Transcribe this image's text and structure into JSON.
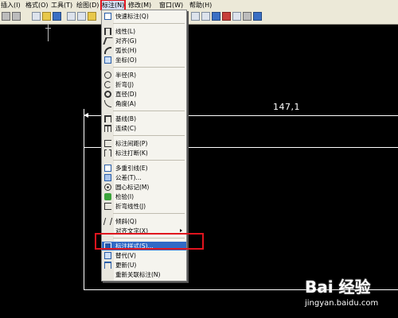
{
  "menubar": {
    "items": [
      {
        "label": "插入(I)"
      },
      {
        "label": "格式(O)"
      },
      {
        "label": "工具(T)"
      },
      {
        "label": "绘图(D)"
      },
      {
        "label": "标注(N)"
      },
      {
        "label": "修改(M)"
      },
      {
        "label": "窗口(W)"
      },
      {
        "label": "帮助(H)"
      }
    ]
  },
  "canvas": {
    "dimension_text": "147,1"
  },
  "dimension_menu": {
    "items": [
      {
        "label": "快速标注(Q)"
      },
      {
        "label": "线性(L)"
      },
      {
        "label": "对齐(G)"
      },
      {
        "label": "弧长(H)"
      },
      {
        "label": "坐标(O)"
      },
      {
        "label": "半径(R)"
      },
      {
        "label": "折弯(J)"
      },
      {
        "label": "直径(D)"
      },
      {
        "label": "角度(A)"
      },
      {
        "label": "基线(B)"
      },
      {
        "label": "连续(C)"
      },
      {
        "label": "标注间距(P)"
      },
      {
        "label": "标注打断(K)"
      },
      {
        "label": "多重引线(E)"
      },
      {
        "label": "公差(T)..."
      },
      {
        "label": "圆心标记(M)"
      },
      {
        "label": "检验(I)"
      },
      {
        "label": "折弯线性(J)"
      },
      {
        "label": "倾斜(Q)"
      },
      {
        "label": "对齐文字(X)"
      },
      {
        "label": "标注样式(S)..."
      },
      {
        "label": "替代(V)"
      },
      {
        "label": "更新(U)"
      },
      {
        "label": "重新关联标注(N)"
      }
    ]
  },
  "watermark": {
    "brand": "Bai 经验",
    "url": "jingyan.baidu.com"
  },
  "colors": {
    "highlight": "#316ac5",
    "annotation_box": "#e0141e",
    "menu_bg": "#f5f4ee",
    "canvas_bg": "#000000"
  }
}
